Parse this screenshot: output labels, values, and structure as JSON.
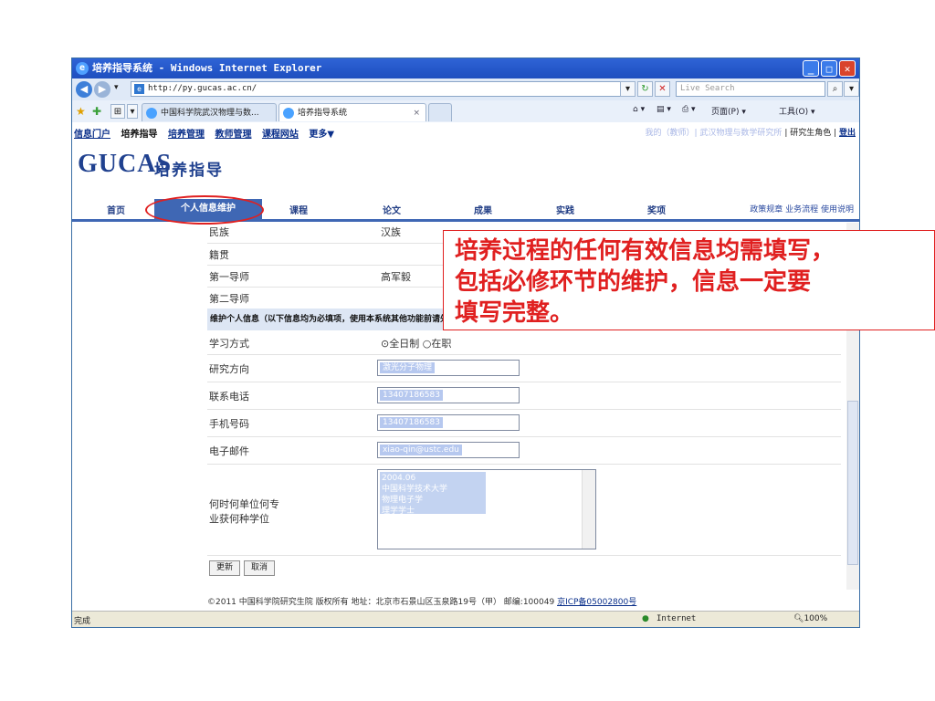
{
  "browser": {
    "window_title": "培养指导系统 - Windows Internet Explorer",
    "url": "http://py.gucas.ac.cn/",
    "search_placeholder": "Live Search",
    "tabs": [
      {
        "label": "中国科学院武汉物理与数...",
        "active": false
      },
      {
        "label": "培养指导系统",
        "active": true
      }
    ],
    "command_bar": [
      "页面(P)",
      "工具(O)"
    ],
    "status_left": "完成",
    "status_zone": "Internet",
    "zoom": "100%"
  },
  "site": {
    "top_links": [
      "信息门户",
      "培养指导",
      "培养管理",
      "教师管理",
      "课程网站",
      "更多▼"
    ],
    "right_links_blurred": "我的（教师）| 武汉物理与数学研究所",
    "right_links": "| 研究生角色 |",
    "logout": "登出",
    "logo": "GUCAS",
    "logo_sub": "培养指导",
    "nav": [
      "首页",
      "个人信息维护",
      "课程",
      "论文",
      "成果",
      "实践",
      "奖项"
    ],
    "nav_right": "政策规章  业务流程  使用说明"
  },
  "form": {
    "rows": [
      {
        "label": "民族",
        "value": "汉族"
      },
      {
        "label": "籍贯",
        "value": ""
      },
      {
        "label": "第一导师",
        "value": "高军毅"
      },
      {
        "label": "第二导师",
        "value": ""
      }
    ],
    "section_header": "维护个人信息（以下信息均为必填项，使用本系统其他功能前请先完善个人信息）",
    "study_mode_label": "学习方式",
    "study_mode_options": [
      "全日制",
      "在职"
    ],
    "fields": [
      {
        "label": "研究方向",
        "value": "激光分子物理"
      },
      {
        "label": "联系电话",
        "value": "13407186583"
      },
      {
        "label": "手机号码",
        "value": "13407186583"
      },
      {
        "label": "电子邮件",
        "value": "xiao-qin@ustc.edu"
      }
    ],
    "degree_label_1": "何时何单位何专",
    "degree_label_2": "业获何种学位",
    "degree_lines": [
      "2004.06",
      "中国科学技术大学",
      "物理电子学",
      "理学学士"
    ],
    "update_button": "更新",
    "cancel_button": "取消"
  },
  "footer": {
    "text": "©2011 中国科学院研究生院 版权所有   地址：北京市石景山区玉泉路19号（甲）  邮编:100049 ",
    "icp": "京ICP备05002800号"
  },
  "annotation": {
    "line1": "培养过程的任何有效信息均需填写，",
    "line2": "包括必修环节的维护，信息一定要",
    "line3": "填写完整。"
  },
  "colors": {
    "accent": "#3f67b4",
    "annotation_red": "#e02020",
    "logo_blue": "#20418f"
  }
}
